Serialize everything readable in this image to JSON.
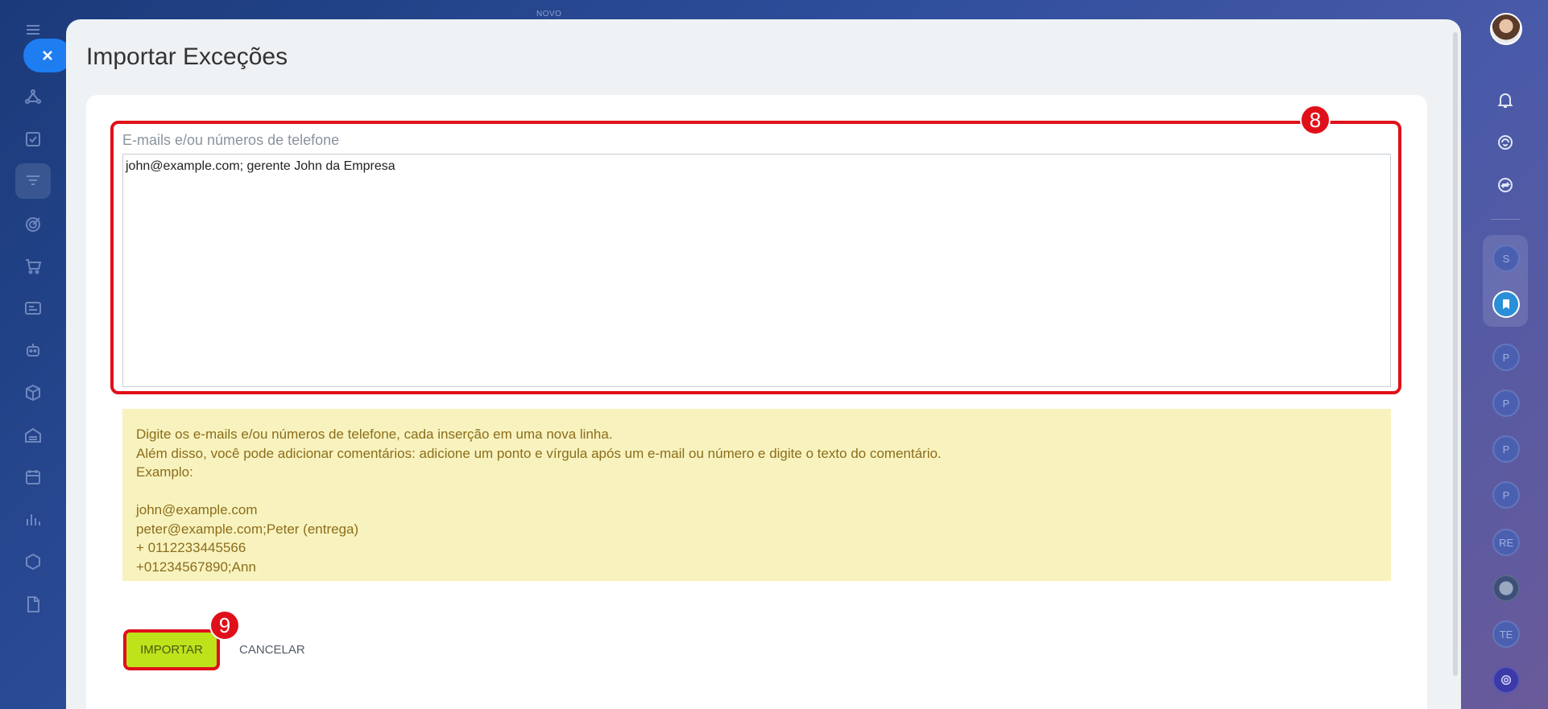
{
  "top_label": "NOVO",
  "page": {
    "title": "Importar Exceções"
  },
  "form": {
    "field_label": "E-mails e/ou números de telefone",
    "field_value": "john@example.com; gerente John da Empresa",
    "hint_lines": [
      "Digite os e-mails e/ou números de telefone, cada inserção em uma nova linha.",
      "Além disso, você pode adicionar comentários: adicione um ponto e vírgula após um e-mail ou número e digite o texto do comentário.",
      "Examplo:",
      "",
      "john@example.com",
      "peter@example.com;Peter (entrega)",
      "+ 0112233445566",
      "+01234567890;Ann"
    ],
    "import_label": "IMPORTAR",
    "cancel_label": "CANCELAR"
  },
  "badges": {
    "field_badge": "8",
    "import_badge": "9"
  },
  "right_rail": {
    "avatars": [
      "S",
      "P",
      "P",
      "P",
      "P",
      "RE",
      "TE"
    ]
  },
  "colors": {
    "accent": "#1f7df2",
    "highlight": "#e0101a",
    "import_button": "#bde31b",
    "hint_bg": "#f8f3be"
  }
}
